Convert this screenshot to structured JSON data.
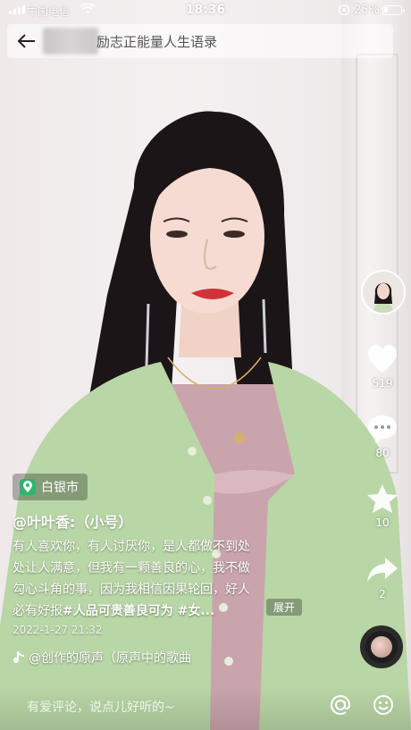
{
  "status_bar": {
    "carrier": "中国电信",
    "time": "18:36",
    "battery": "25%",
    "battery_level": 0.25
  },
  "search": {
    "text": "励志正能量人生语录"
  },
  "right_rail": {
    "like_count": "519",
    "comment_count": "80",
    "favorite_count": "10",
    "share_count": "2"
  },
  "location": {
    "label": "白银市"
  },
  "post": {
    "author": "@叶叶香:（小号）",
    "caption_lines": [
      "有人喜欢你，有人讨厌你，是人都做不到处",
      "处让人满意，但我有一颗善良的心，我不做",
      "勾心斗角的事，因为我相信因果轮回，好人",
      "必有好报"
    ],
    "caption_tags": "#人品可贵善良可为 #女...",
    "expand_label": "展开",
    "date": "2022-1-27 21:32",
    "music": "@创作的原声（原声中的歌曲"
  },
  "comment_bar": {
    "placeholder": "有爱评论，说点儿好听的~"
  },
  "colors": {
    "location_pin": "#2fb46e",
    "cardigan": "#b9d6a6",
    "top": "#c9a4ad"
  }
}
